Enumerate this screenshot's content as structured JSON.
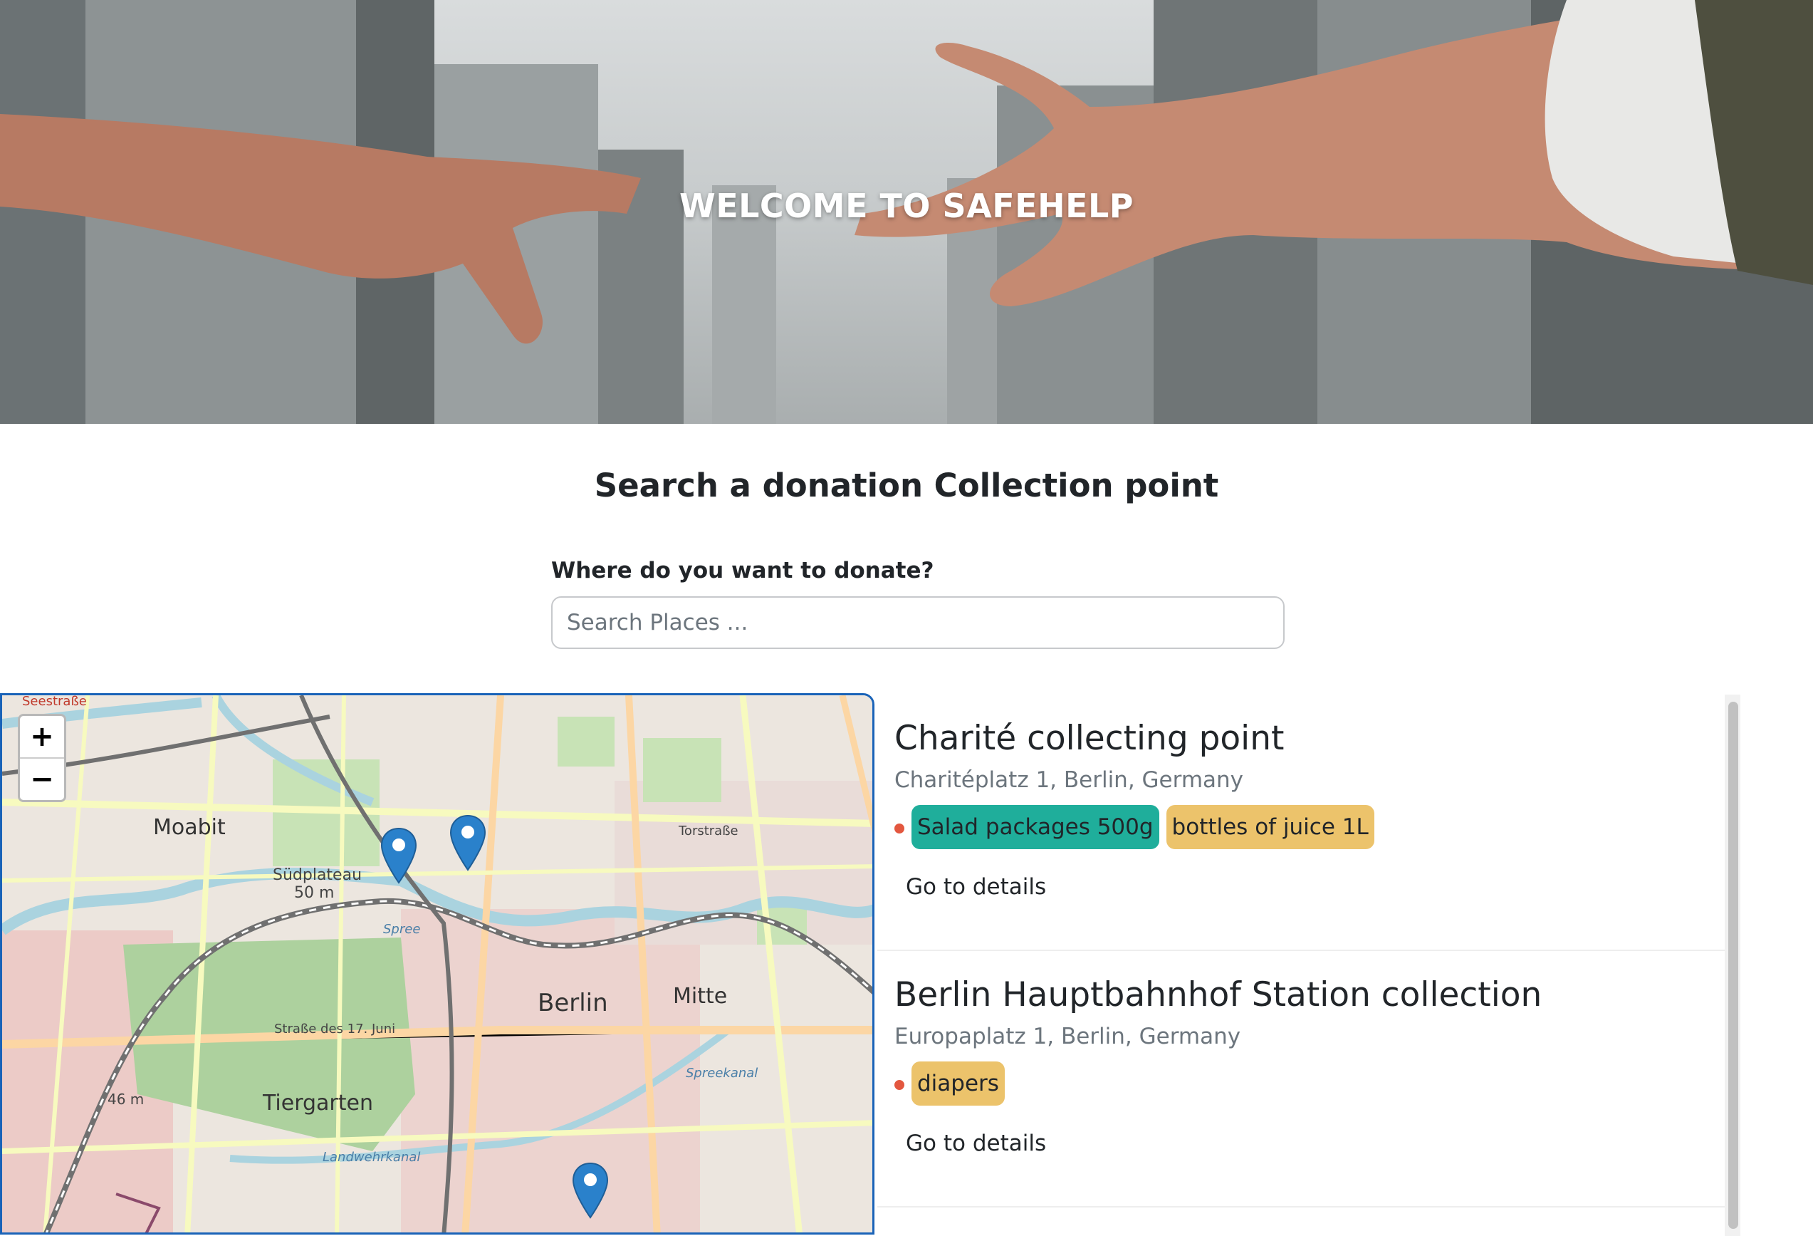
{
  "hero": {
    "title": "WELCOME TO SAFEHELP"
  },
  "search": {
    "heading": "Search a donation Collection point",
    "label": "Where do you want to donate?",
    "placeholder": "Search Places ...",
    "value": ""
  },
  "map": {
    "zoom_in_label": "+",
    "zoom_out_label": "−",
    "labels": {
      "moabit": "Moabit",
      "berlin": "Berlin",
      "mitte": "Mitte",
      "tiergarten": "Tiergarten",
      "suedplateau": "Südplateau",
      "suedplateau_height": "50 m",
      "seestrasse": "Seestraße",
      "torstrasse": "Torstraße",
      "strasse17juni": "Straße des 17. Juni",
      "landwehrkanal": "Landwehrkanal",
      "spreekanal": "Spreekanal",
      "spree": "Spree",
      "height46": "46 m"
    },
    "marker_icon": "map-marker-icon",
    "marker_color": "#2a81cb"
  },
  "colors": {
    "tag_teal": "#1fae9b",
    "tag_amber": "#ecc36b",
    "status_dot": "#e3573f",
    "map_border": "#1a63b8"
  },
  "collection_points": [
    {
      "name": "Charité collecting point",
      "address": "Charitéplatz 1, Berlin, Germany",
      "tags": [
        {
          "label": "Salad packages 500g",
          "color": "#1fae9b"
        },
        {
          "label": "bottles of juice 1L",
          "color": "#ecc36b"
        }
      ],
      "link": "Go to details"
    },
    {
      "name": "Berlin Hauptbahnhof Station collection",
      "address": "Europaplatz 1, Berlin, Germany",
      "tags": [
        {
          "label": "diapers",
          "color": "#ecc36b"
        }
      ],
      "link": "Go to details"
    }
  ]
}
